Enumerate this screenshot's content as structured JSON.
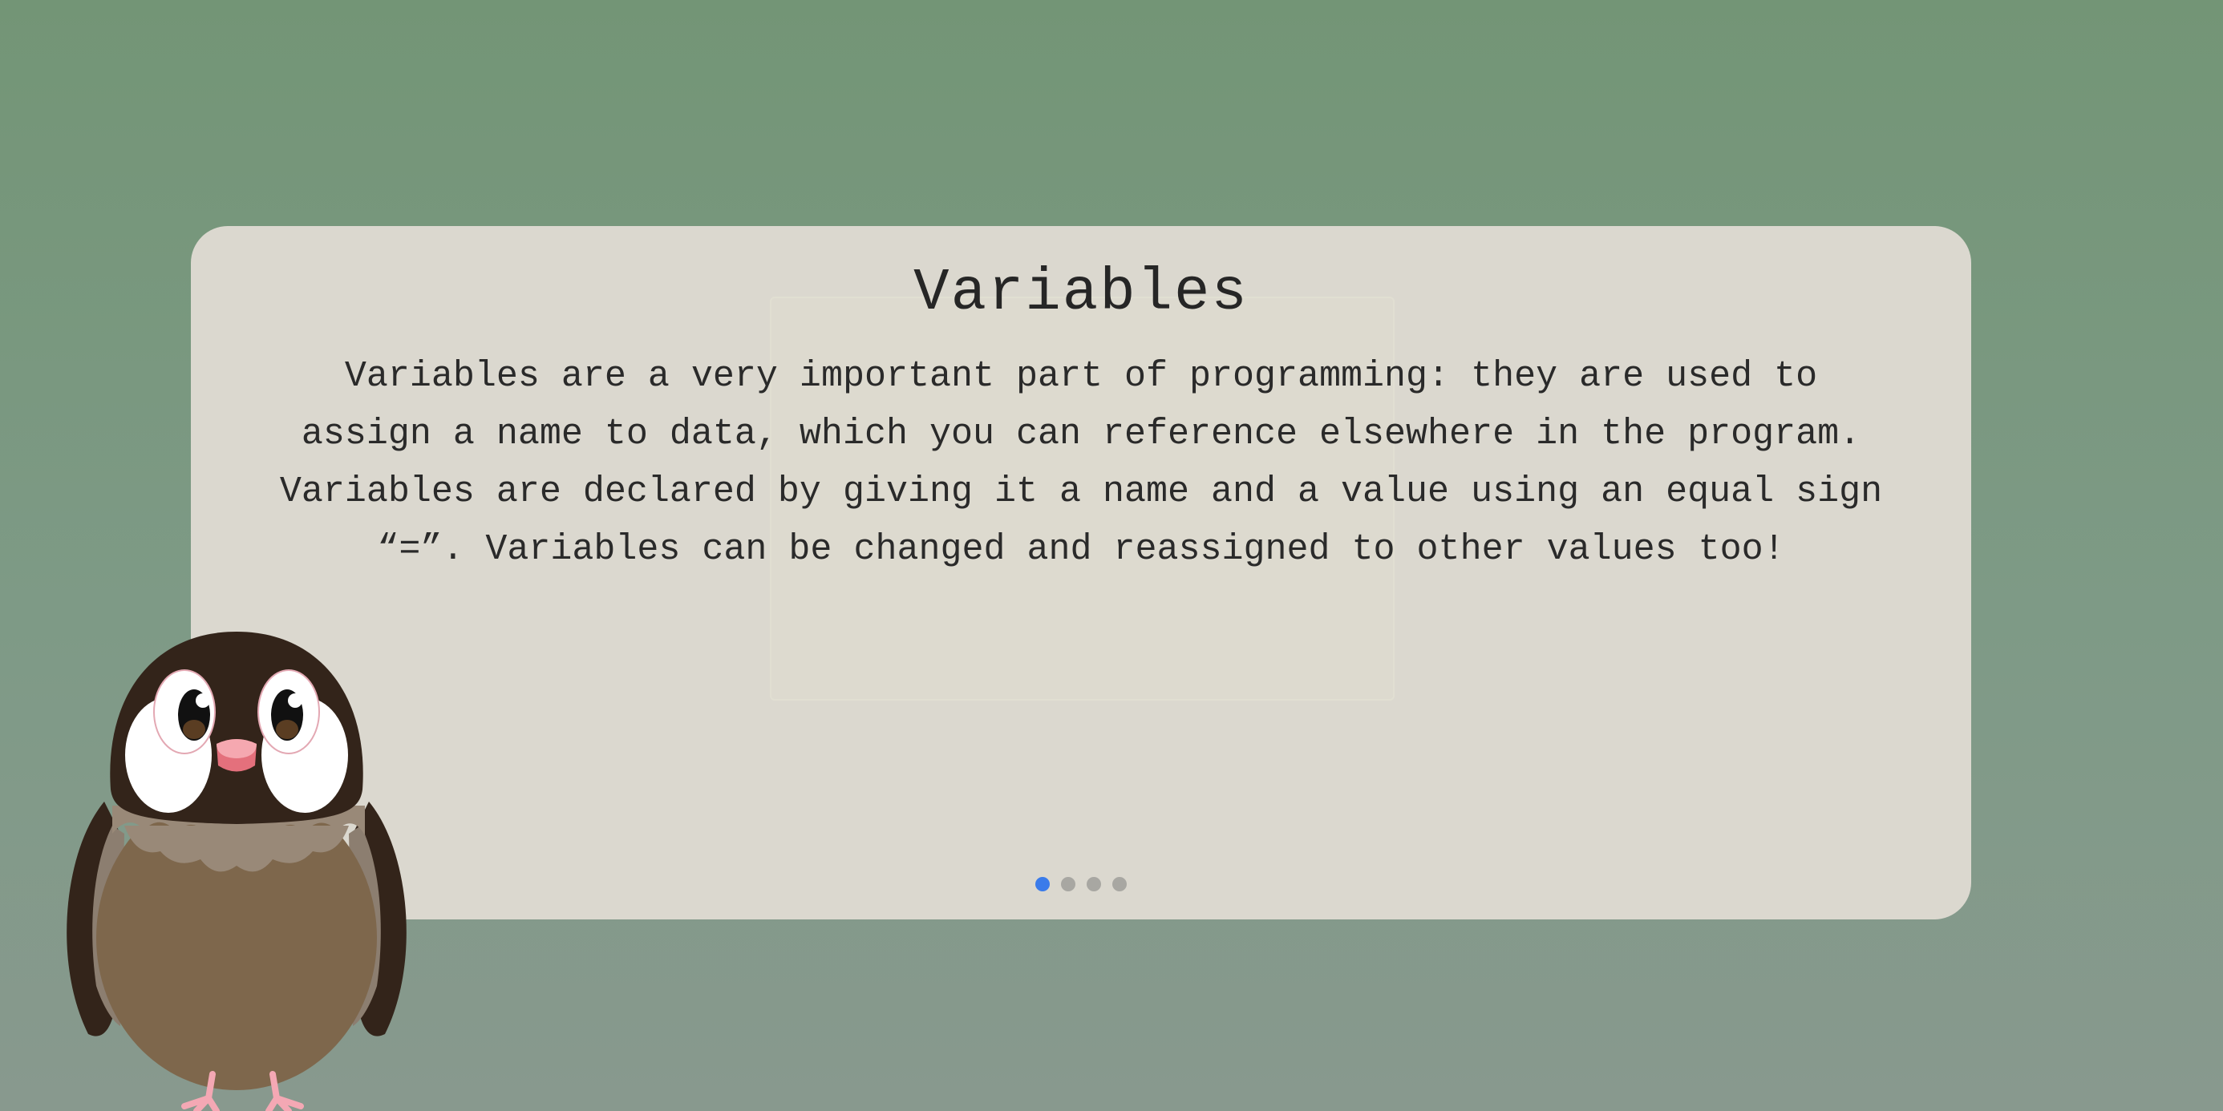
{
  "lesson": {
    "title": "Variables",
    "body": "Variables are a very important part of programming: they are used to assign a name to data, which you can reference elsewhere in the program. Variables are declared by giving it a name and a value using an equal sign “=”. Variables can be changed and reassigned to other values too!"
  },
  "pagination": {
    "total_pages": 4,
    "current_page": 1,
    "active_color": "#3a7bea",
    "inactive_color": "#a8a7a2"
  },
  "colors": {
    "background": "#7a9880",
    "card": "#dbd8cf",
    "text": "#2a2a2a"
  },
  "mascot": {
    "icon": "owl-mascot-icon"
  }
}
